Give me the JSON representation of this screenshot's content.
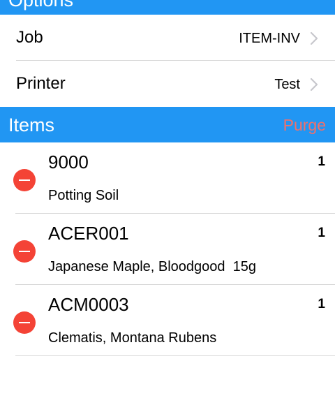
{
  "options": {
    "title": "Options",
    "rows": [
      {
        "label": "Job",
        "value": "ITEM-INV"
      },
      {
        "label": "Printer",
        "value": "Test"
      }
    ]
  },
  "items_section": {
    "title": "Items",
    "purge_label": "Purge"
  },
  "items": [
    {
      "code": "9000",
      "description": "Potting Soil",
      "qty": "1"
    },
    {
      "code": "ACER001",
      "description": "Japanese Maple, Bloodgood  15g",
      "qty": "1"
    },
    {
      "code": "ACM0003",
      "description": "Clematis, Montana Rubens",
      "qty": "1"
    }
  ],
  "colors": {
    "header": "#2196f3",
    "purge": "#f1706a",
    "delete": "#f44336"
  },
  "icons": {
    "chevron": "chevron-right-icon",
    "delete": "remove-circle-icon"
  }
}
